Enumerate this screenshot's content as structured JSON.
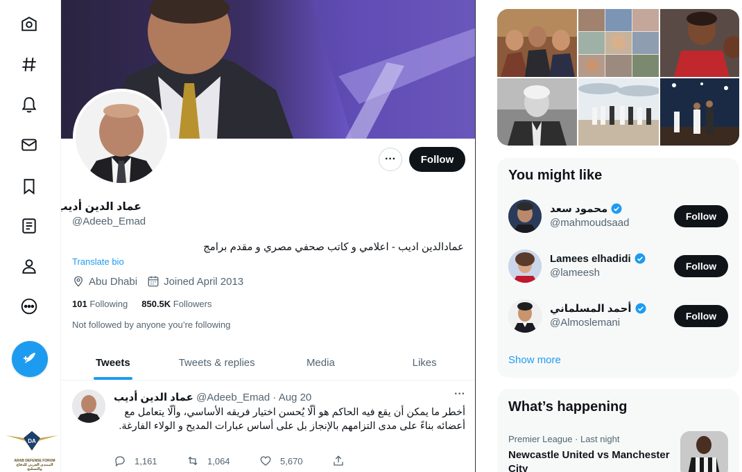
{
  "nav": {
    "items": [
      "home-icon",
      "explore-icon",
      "notifications-icon",
      "messages-icon",
      "bookmarks-icon",
      "lists-icon",
      "profile-icon",
      "more-icon"
    ],
    "tweet_button": "compose-tweet-icon"
  },
  "forum_logo": {
    "line1": "ARAB DEFENSE FORUM",
    "line2": "المنتدى العربي للدفاع والتسليح"
  },
  "profile": {
    "name": "عماد الدين أديب",
    "handle": "@Adeeb_Emad",
    "bio": "عمادالدين اديب - اعلامي و كاتب صحفي مصري و مقدم برامج",
    "translate_label": "Translate bio",
    "location": "Abu Dhabi",
    "joined": "Joined April 2013",
    "following_count": "101",
    "following_label": "Following",
    "followers_count": "850.5K",
    "followers_label": "Followers",
    "not_followed": "Not followed by anyone you’re following",
    "follow_label": "Follow",
    "more_label": "···"
  },
  "tabs": [
    "Tweets",
    "Tweets & replies",
    "Media",
    "Likes"
  ],
  "active_tab": "Tweets",
  "tweet": {
    "name": "عماد الدين أديب",
    "handle": "@Adeeb_Emad",
    "date": "· Aug 20",
    "more": "···",
    "text": "أخطر ما يمكن أن يقع فيه الحاكم هو ألّا يُحسن اختيار فريقه الأساسي، وألّا يتعامل مع أعضائه بناءً على مدى التزامهم بالإنجاز بل على أساس عبارات المديح و الولاء الفارغة.",
    "replies": "1,161",
    "retweets": "1,064",
    "likes": "5,670"
  },
  "you_might_like": {
    "title": "You might like",
    "users": [
      {
        "name": "محمود سعد",
        "handle": "@mahmoudsaad",
        "verified": true
      },
      {
        "name": "Lamees elhadidi",
        "handle": "@lameesh",
        "verified": true
      },
      {
        "name": "أحمد المسلماني",
        "handle": "@Almoslemani",
        "verified": true
      }
    ],
    "follow_label": "Follow",
    "show_more": "Show more"
  },
  "whats_happening": {
    "title": "What’s happening",
    "trend_category": "Premier League · Last night",
    "trend_title": "Newcastle United vs Manchester City"
  },
  "colors": {
    "accent": "#1d9bf0",
    "text": "#0f1419",
    "secondary": "#536471",
    "card": "#f7f9f9"
  }
}
